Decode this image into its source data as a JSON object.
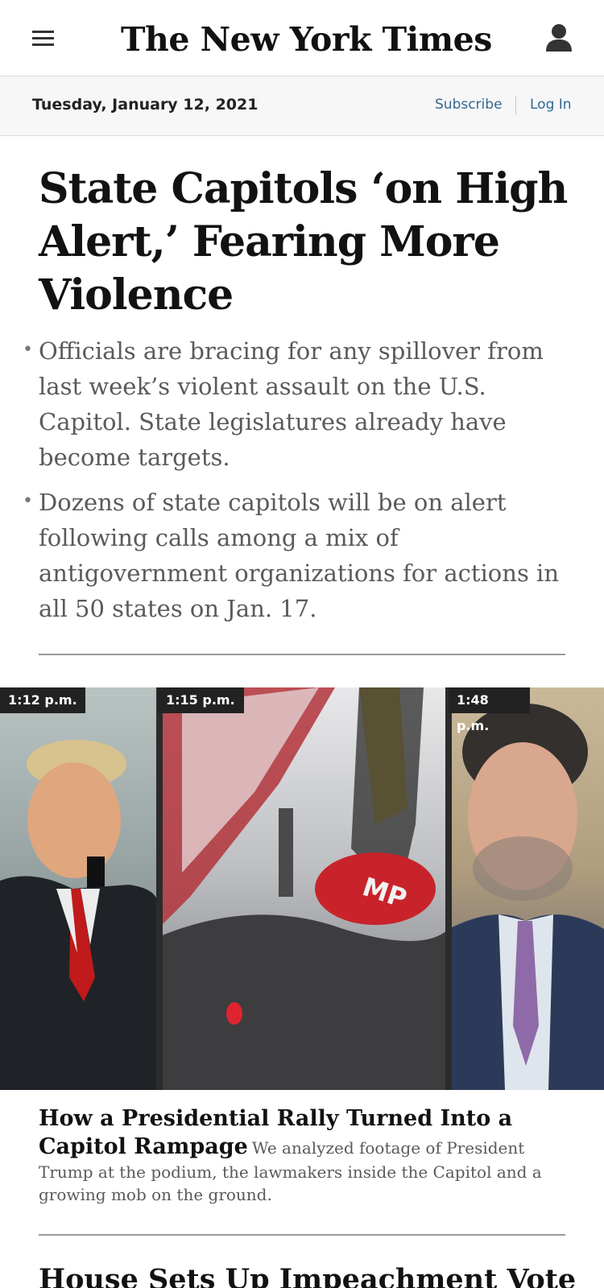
{
  "header": {
    "logo": "The New York Times",
    "menu_icon": "hamburger-menu-icon",
    "account_icon": "user-account-icon"
  },
  "datebar": {
    "date": "Tuesday, January 12, 2021",
    "subscribe": "Subscribe",
    "login": "Log In"
  },
  "lead_story": {
    "headline": "State Capitols ‘on High Alert,’ Fearing More Violence",
    "summaries": [
      "Officials are bracing for any spillover from last week’s violent assault on the U.S. Capitol. State legislatures already have become targets.",
      "Dozens of state capitols will be on alert following calls among a mix of antigovernment organizations for actions in all 50 states on Jan. 17."
    ]
  },
  "media": {
    "timestamps": [
      "1:12 p.m.",
      "1:15 p.m.",
      "1:48 p.m."
    ]
  },
  "story2": {
    "headline": "How a Presidential Rally Turned Into a Capitol Rampage",
    "summary": "We analyzed footage of President Trump at the podium, the lawmakers inside the Capitol and a growing mob on the ground."
  },
  "story3": {
    "headline": "House Sets Up Impeachment Vote to"
  },
  "colors": {
    "link": "#326891",
    "headline": "#121212",
    "summary": "#5a5a5a",
    "datebar_bg": "#f7f7f7"
  }
}
